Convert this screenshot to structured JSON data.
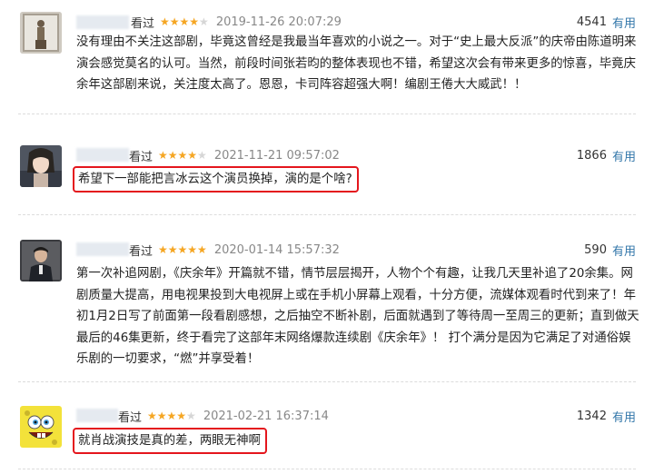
{
  "colors": {
    "star": "#f5a623",
    "useful_link": "#3377aa",
    "highlight_box": "#e4161d"
  },
  "reviews": [
    {
      "status": "看过",
      "rating": 4,
      "time": "2019-11-26 20:07:29",
      "votes": "4541",
      "useful_label": "有用",
      "content": "没有理由不关注这部剧，毕竟这曾经是我最当年喜欢的小说之一。对于“史上最大反派”的庆帝由陈道明来演会感觉莫名的认可。当然，前段时间张若昀的整体表现也不错，希望这次会有带来更多的惊喜，毕竟庆余年这部剧来说，关注度太高了。恩恩，卡司阵容超强大啊！编剧王倦大大威武！！",
      "highlighted": false,
      "avatar": "statue"
    },
    {
      "status": "看过",
      "rating": 4,
      "time": "2021-11-21 09:57:02",
      "votes": "1866",
      "useful_label": "有用",
      "content": "希望下一部能把言冰云这个演员换掉，演的是个啥?",
      "highlighted": true,
      "avatar": "anime-girl"
    },
    {
      "status": "看过",
      "rating": 5,
      "time": "2020-01-14 15:57:32",
      "votes": "590",
      "useful_label": "有用",
      "content": "第一次补追网剧，《庆余年》开篇就不错，情节层层揭开，人物个个有趣，让我几天里补追了20余集。网剧质量大提高，用电视果投到大电视屏上或在手机小屏幕上观看，十分方便，流媒体观看时代到来了！年初1月2日写了前面第一段看剧感想，之后抽空不断补剧，后面就遇到了等待周一至周三的更新；直到做天最后的46集更新，终于看完了这部年末网络爆款连续剧《庆余年》！ 打个满分是因为它满足了对通俗娱乐剧的一切要求，“燃”并享受着！",
      "highlighted": false,
      "avatar": "man-portrait"
    },
    {
      "status": "看过",
      "rating": 4,
      "time": "2021-02-21 16:37:14",
      "votes": "1342",
      "useful_label": "有用",
      "content": "就肖战演技是真的差，两眼无神啊",
      "highlighted": true,
      "avatar": "spongebob"
    }
  ]
}
